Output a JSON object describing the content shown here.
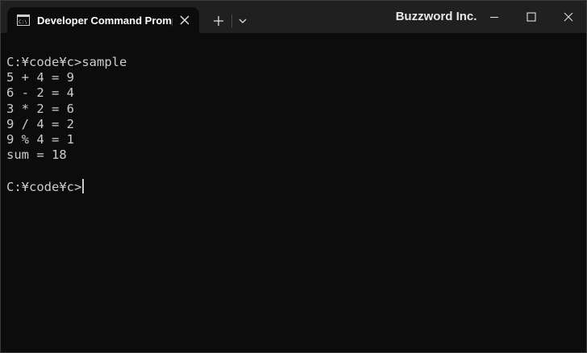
{
  "tab": {
    "icon": "cmd-terminal-icon",
    "title": "Developer Command Prompt"
  },
  "titlebar": {
    "brand": "Buzzword Inc.",
    "new_tab_icon": "plus-icon",
    "dropdown_icon": "chevron-down-icon",
    "minimize_icon": "minimize-icon",
    "maximize_icon": "maximize-icon",
    "close_icon": "close-icon"
  },
  "terminal": {
    "lines": [
      "C:¥code¥c>sample",
      "5 + 4 = 9",
      "6 - 2 = 4",
      "3 * 2 = 6",
      "9 / 4 = 2",
      "9 % 4 = 1",
      "sum = 18",
      "",
      "C:¥code¥c>"
    ]
  },
  "colors": {
    "terminal_bg": "#0c0c0c",
    "titlebar_bg": "#202020",
    "text": "#cccccc"
  }
}
